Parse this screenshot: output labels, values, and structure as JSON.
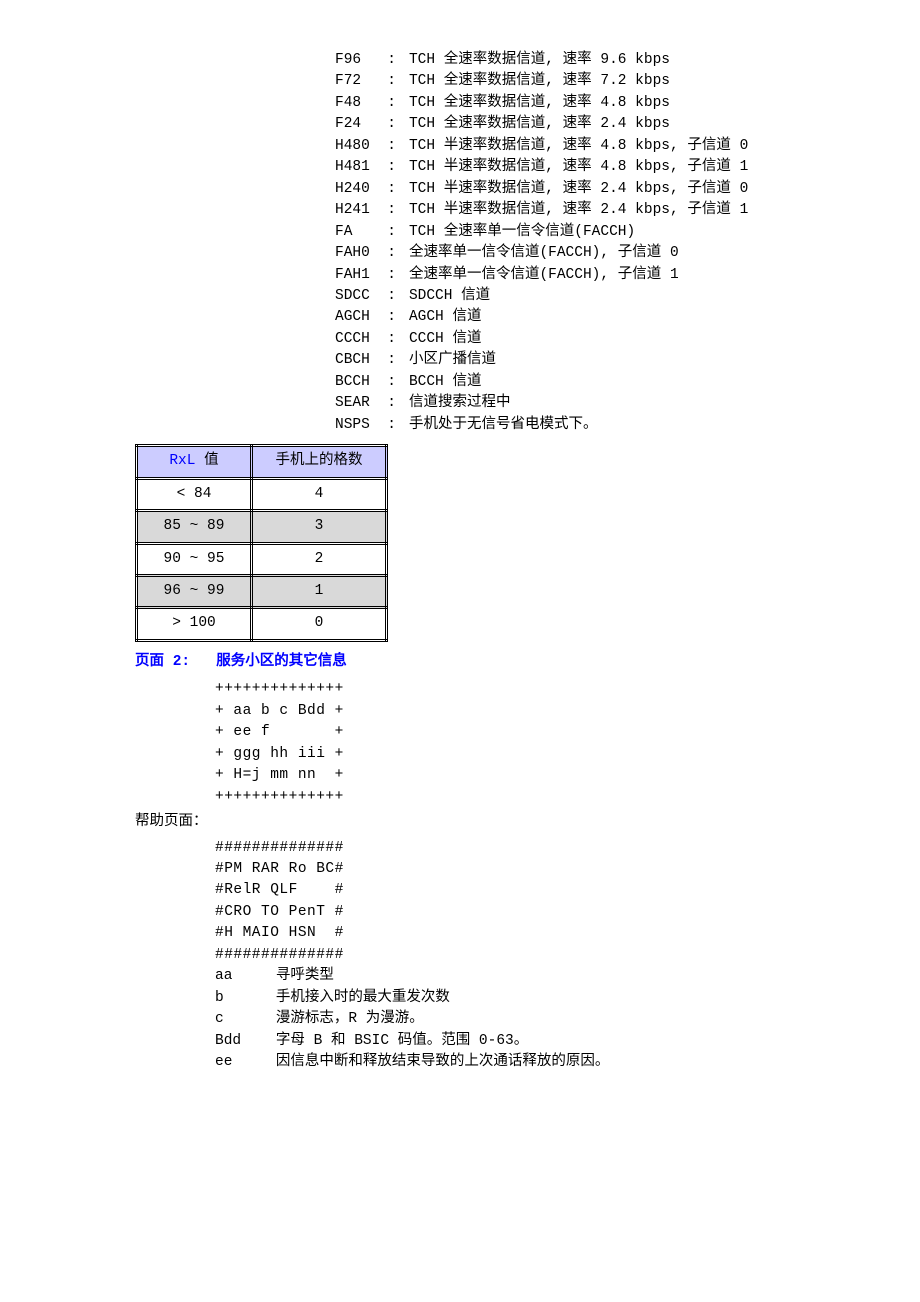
{
  "defs": [
    {
      "k": "F96",
      "v": "TCH 全速率数据信道, 速率 9.6 kbps"
    },
    {
      "k": "F72",
      "v": "TCH 全速率数据信道, 速率 7.2 kbps"
    },
    {
      "k": "F48",
      "v": "TCH 全速率数据信道, 速率 4.8 kbps"
    },
    {
      "k": "F24",
      "v": "TCH 全速率数据信道, 速率 2.4 kbps"
    },
    {
      "k": "H480",
      "v": "TCH 半速率数据信道, 速率 4.8 kbps, 子信道 0"
    },
    {
      "k": "H481",
      "v": "TCH 半速率数据信道, 速率 4.8 kbps, 子信道 1"
    },
    {
      "k": "H240",
      "v": "TCH 半速率数据信道, 速率 2.4 kbps, 子信道 0"
    },
    {
      "k": "H241",
      "v": "TCH 半速率数据信道, 速率 2.4 kbps, 子信道 1"
    },
    {
      "k": "FA",
      "v": "TCH 全速率单一信令信道(FACCH)"
    },
    {
      "k": "FAH0",
      "v": "全速率单一信令信道(FACCH), 子信道 0"
    },
    {
      "k": "FAH1",
      "v": "全速率单一信令信道(FACCH), 子信道 1"
    },
    {
      "k": "SDCC",
      "v": "SDCCH 信道"
    },
    {
      "k": "AGCH",
      "v": "AGCH 信道"
    },
    {
      "k": "CCCH",
      "v": "CCCH 信道"
    },
    {
      "k": "CBCH",
      "v": "小区广播信道"
    },
    {
      "k": "BCCH",
      "v": "BCCH 信道"
    },
    {
      "k": "SEAR",
      "v": "信道搜索过程中"
    },
    {
      "k": "NSPS",
      "v": "手机处于无信号省电模式下。"
    }
  ],
  "table": {
    "header": {
      "c1_link": "RxL",
      "c1_suffix": " 值",
      "c2": "手机上的格数"
    },
    "rows": [
      {
        "c1": "< 84",
        "c2": "4",
        "shade": false
      },
      {
        "c1": "85 ~ 89",
        "c2": "3",
        "shade": true
      },
      {
        "c1": "90 ~ 95",
        "c2": "2",
        "shade": false
      },
      {
        "c1": "96 ~ 99",
        "c2": "1",
        "shade": true
      },
      {
        "c1": "> 100",
        "c2": "0",
        "shade": false
      }
    ]
  },
  "page2": {
    "label": "页面 2:",
    "title": "服务小区的其它信息",
    "block": "++++++++++++++\n+ aa b c Bdd +\n+ ee f       +\n+ ggg hh iii +\n+ H=j mm nn  +\n++++++++++++++"
  },
  "help": {
    "label": "帮助页面：",
    "block": "##############\n#PM RAR Ro BC#\n#RelR QLF    #\n#CRO TO PenT #\n#H MAIO HSN  #\n##############",
    "params": [
      {
        "k": "aa",
        "v": "寻呼类型"
      },
      {
        "k": "b",
        "v": "手机接入时的最大重发次数"
      },
      {
        "k": "c",
        "v": "漫游标志，R 为漫游。"
      },
      {
        "k": "Bdd",
        "v": "字母 B 和 BSIC 码值。范围 0-63。"
      },
      {
        "k": "ee",
        "v": "因信息中断和释放结束导致的上次通话释放的原因。"
      }
    ]
  }
}
